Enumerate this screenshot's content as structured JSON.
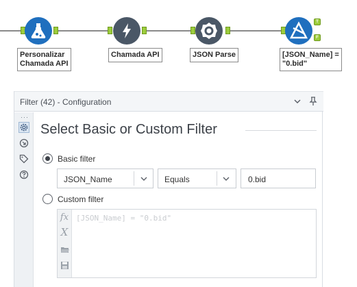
{
  "workflow": {
    "tools": [
      {
        "name": "formula-tool",
        "label_line1": "Personalizar",
        "label_line2": "Chamada API"
      },
      {
        "name": "download-tool",
        "label_line1": "Chamada API",
        "label_line2": ""
      },
      {
        "name": "json-parse-tool",
        "label_line1": "JSON Parse",
        "label_line2": ""
      },
      {
        "name": "filter-tool",
        "label_line1": "[JSON_Name] =",
        "label_line2": "\"0.bid\""
      }
    ],
    "filter_outputs": {
      "true_label": "T",
      "false_label": "F"
    },
    "anchor_color": "#9ccc3c",
    "formula_color": "#1f6fbe",
    "tool_color": "#4a5766"
  },
  "panel": {
    "title": "Filter (42) - Configuration",
    "icons": [
      "chevron-down-icon",
      "pin-icon"
    ],
    "side_icons": [
      "settings-icon",
      "annotation-icon",
      "tag-icon",
      "help-icon"
    ],
    "section_title": "Select Basic or Custom Filter",
    "basic": {
      "label": "Basic filter",
      "selected": true,
      "field": "JSON_Name",
      "operator": "Equals",
      "value": "0.bid"
    },
    "custom": {
      "label": "Custom filter",
      "selected": false,
      "expression": "[JSON_Name] = \"0.bid\"",
      "toolbar_icons": [
        "fx-icon",
        "variable-icon",
        "open-folder-icon",
        "save-icon"
      ]
    }
  }
}
